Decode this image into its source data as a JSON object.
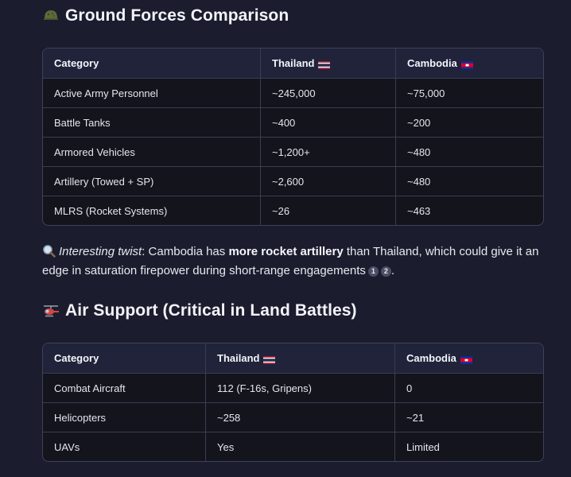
{
  "section1": {
    "title": "Ground Forces Comparison",
    "icon": "military-helmet-icon",
    "headers": [
      "Category",
      "Thailand",
      "Cambodia"
    ],
    "rows": [
      [
        "Active Army Personnel",
        "~245,000",
        "~75,000"
      ],
      [
        "Battle Tanks",
        "~400",
        "~200"
      ],
      [
        "Armored Vehicles",
        "~1,200+",
        "~480"
      ],
      [
        "Artillery (Towed + SP)",
        "~2,600",
        "~480"
      ],
      [
        "MLRS (Rocket Systems)",
        "~26",
        "~463"
      ]
    ]
  },
  "note": {
    "icon": "magnifying-glass-icon",
    "lead": "Interesting twist",
    "text1": ": Cambodia has ",
    "bold": "more rocket artillery",
    "text2": " than Thailand, which could give it an edge in saturation firepower during short-range engagements",
    "citations": [
      "1",
      "2"
    ],
    "end": "."
  },
  "section2": {
    "title": "Air Support (Critical in Land Battles)",
    "icon": "helicopter-icon",
    "headers": [
      "Category",
      "Thailand",
      "Cambodia"
    ],
    "rows": [
      [
        "Combat Aircraft",
        "112 (F-16s, Gripens)",
        "0"
      ],
      [
        "Helicopters",
        "~258",
        "~21"
      ],
      [
        "UAVs",
        "Yes",
        "Limited"
      ]
    ]
  },
  "colors": {
    "background": "#1b1d2e",
    "table_header": "#20233a",
    "table_body": "#13141c",
    "border": "#3a3d52"
  }
}
